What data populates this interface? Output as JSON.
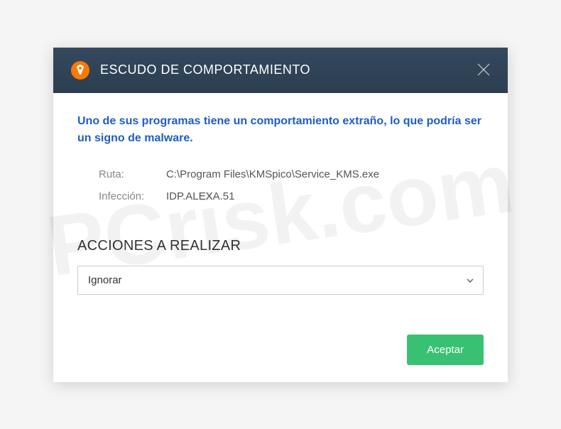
{
  "header": {
    "title": "ESCUDO DE COMPORTAMIENTO"
  },
  "warning_text": "Uno de sus programas tiene un comportamiento extraño, lo que podría ser un signo de malware.",
  "details": {
    "path_label": "Ruta:",
    "path_value": "C:\\Program Files\\KMSpico\\Service_KMS.exe",
    "infection_label": "Infección:",
    "infection_value": "IDP.ALEXA.51"
  },
  "actions": {
    "section_title": "ACCIONES A REALIZAR",
    "selected_option": "Ignorar"
  },
  "footer": {
    "accept_label": "Aceptar"
  },
  "watermark": "PCrisk.com"
}
